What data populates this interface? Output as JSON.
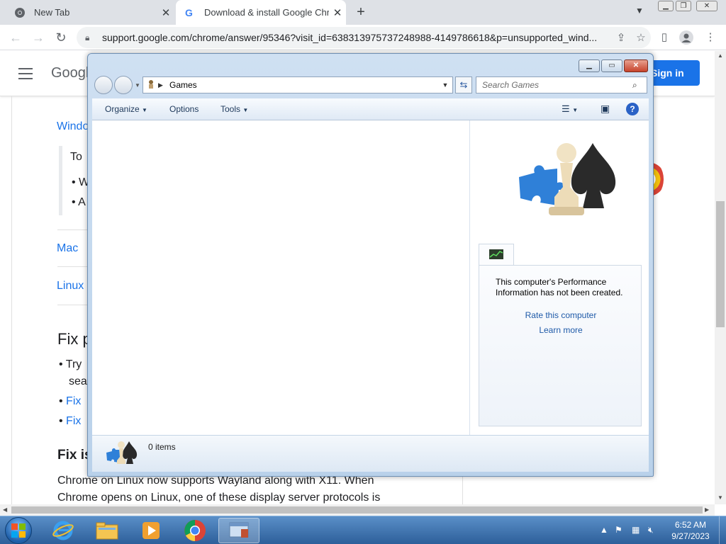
{
  "browser": {
    "tabs": [
      {
        "title": "New Tab",
        "active": false
      },
      {
        "title": "Download & install Google Chrome",
        "active": true
      }
    ],
    "url": "support.google.com/chrome/answer/95346?visit_id=638313975737248988-4149786618&p=unsupported_wind..."
  },
  "page": {
    "logo": "Googl",
    "signin_label": "Sign in",
    "lines": {
      "windows_link": "Windo",
      "callout_to": "To",
      "bullet_1": "W",
      "bullet_2": "A",
      "mac_link": "Mac",
      "linux_link": "Linux",
      "fix_heading": "Fix p",
      "try_text": "Try",
      "search_text": "sea",
      "fix_link_1": "Fix",
      "fix_link_2": "Fix",
      "fix_is_heading": "Fix is",
      "para_1": "Chrome on Linux now supports Wayland along with X11. When",
      "para_2": "Chrome opens on Linux, one of these display server protocols is"
    }
  },
  "explorer": {
    "breadcrumb": "Games",
    "search_placeholder": "Search Games",
    "commands": {
      "organize": "Organize",
      "options": "Options",
      "tools": "Tools"
    },
    "perf_text": "This computer's Performance Information has not been created.",
    "rate_link": "Rate this computer",
    "learn_link": "Learn more",
    "items_count": "0 items"
  },
  "taskbar": {
    "time": "6:52 AM",
    "date": "9/27/2023"
  },
  "colors": {
    "chrome_accent": "#1a73e8",
    "win_title_gradient": "#cfe0f2",
    "taskbar": "#2d5f9a"
  }
}
